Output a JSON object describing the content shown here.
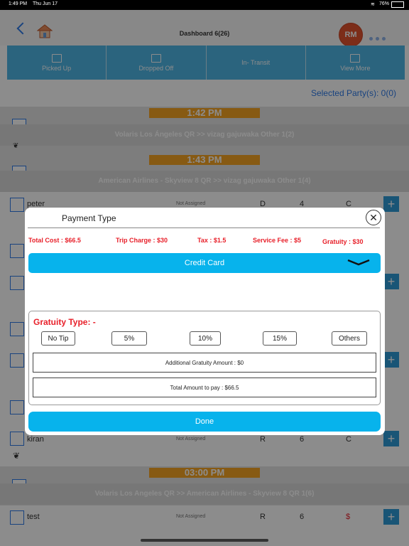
{
  "status": {
    "time": "1:49 PM",
    "date": "Thu Jun 17",
    "battery": "76%"
  },
  "nav": {
    "title": "Dashboard 6(26)",
    "avatar": "RM"
  },
  "tabs": [
    {
      "label": "Picked Up"
    },
    {
      "label": "Dropped Off"
    },
    {
      "label": "In- Transit"
    },
    {
      "label": "View More"
    }
  ],
  "selected_party": "Selected Party(s): 0(0)",
  "list": {
    "groups": [
      {
        "time": "1:42 PM",
        "route": "Volaris Los Ángeles  QR >> vizag gajuwaka Other 1(2)"
      },
      {
        "time": "1:43 PM",
        "route": "American Airlines - Skyview 8  QR >> vizag gajuwaka Other 1(4)"
      },
      {
        "time": "03:00 PM",
        "route": "Volaris Los Angeles  QR >> American Airlines - Skyview 8  QR 1(6)"
      }
    ],
    "rows": [
      {
        "name": "peter",
        "driver": "Not Assigned",
        "c1": "D",
        "c2": "4",
        "c3": "C"
      },
      {
        "name": "kiran",
        "driver": "Not Assigned",
        "c1": "R",
        "c2": "6",
        "c3": "C"
      },
      {
        "name": "test",
        "driver": "Not Assigned",
        "c1": "R",
        "c2": "6",
        "c3": "$"
      }
    ]
  },
  "modal": {
    "title": "Payment Type",
    "total_cost": "Total Cost : $66.5",
    "trip_charge": "Trip Charge : $30",
    "tax": "Tax : $1.5",
    "service_fee": "Service Fee : $5",
    "gratuity": "Gratuity : $30",
    "payment_method": "Credit Card",
    "gratuity_type_label": "Gratuity Type: -",
    "gratuity_options": [
      "No Tip",
      "5%",
      "10%",
      "15%",
      "Others"
    ],
    "additional_gratuity": "Additional Gratuity Amount : $0",
    "total_to_pay": "Total Amount to pay : $66.5",
    "done_label": "Done"
  },
  "colors": {
    "accent": "#07b3ec",
    "tab_bar": "#4fb7e6",
    "time_badge": "#f6a424",
    "cost_red": "#e8202a",
    "avatar": "#e2532f"
  }
}
